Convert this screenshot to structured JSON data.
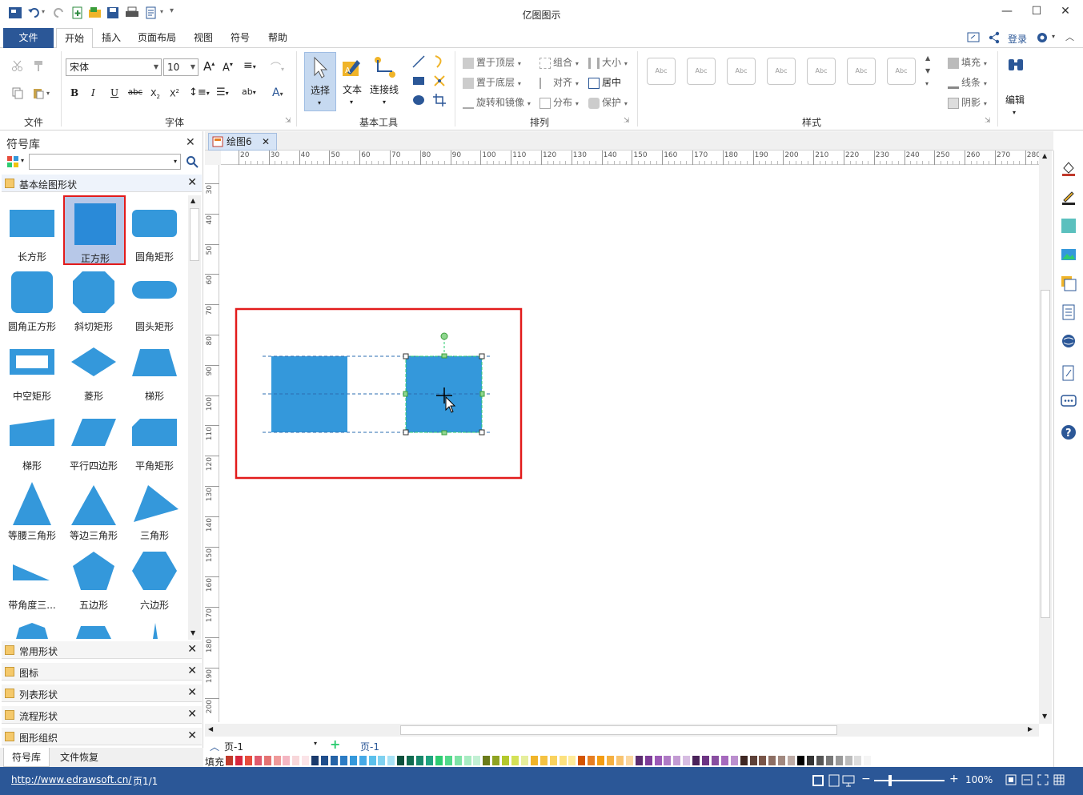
{
  "app": {
    "title": "亿图图示"
  },
  "menu": [
    "文件",
    "开始",
    "插入",
    "页面布局",
    "视图",
    "符号",
    "帮助"
  ],
  "account": {
    "login": "登录"
  },
  "ribbon": {
    "groups": {
      "file": "文件",
      "font": "字体",
      "basic_tools": "基本工具",
      "arrange": "排列",
      "style": "样式"
    },
    "font": {
      "family": "宋体",
      "size": "10"
    },
    "tools": {
      "select": "选择",
      "text": "文本",
      "connector": "连接线"
    },
    "arrange": {
      "bring_front": "置于顶层",
      "group": "组合",
      "size": "大小",
      "send_back": "置于底层",
      "align": "对齐",
      "center": "居中",
      "rotate_mirror": "旋转和镜像",
      "distribute": "分布",
      "protect": "保护"
    },
    "style_thumbs": [
      "Abc",
      "Abc",
      "Abc",
      "Abc",
      "Abc",
      "Abc",
      "Abc"
    ],
    "fill": {
      "fill": "填充",
      "line": "线条",
      "shadow": "阴影"
    },
    "edit": "编辑"
  },
  "library": {
    "title": "符号库",
    "section": "基本绘图形状",
    "shapes": [
      "长方形",
      "正方形",
      "圆角矩形",
      "圆角正方形",
      "斜切矩形",
      "圆头矩形",
      "中空矩形",
      "菱形",
      "梯形",
      "梯形",
      "平行四边形",
      "平角矩形",
      "等腰三角形",
      "等边三角形",
      "三角形",
      "带角度三...",
      "五边形",
      "六边形"
    ],
    "other_sections": [
      "常用形状",
      "图标",
      "列表形状",
      "流程形状",
      "图形组织"
    ],
    "bottom_tabs": [
      "符号库",
      "文件恢复"
    ]
  },
  "document": {
    "tab": "绘图6"
  },
  "rulers": {
    "h": [
      "20",
      "30",
      "40",
      "50",
      "60",
      "70",
      "80",
      "90",
      "100",
      "110",
      "120",
      "130",
      "140",
      "150",
      "160",
      "170",
      "180",
      "190",
      "200",
      "210",
      "220",
      "230",
      "240",
      "250",
      "260",
      "270",
      "280"
    ],
    "v": [
      "30",
      "40",
      "50",
      "60",
      "70",
      "80",
      "90",
      "100",
      "110",
      "120",
      "130",
      "140",
      "150",
      "160",
      "170",
      "180",
      "190",
      "200"
    ]
  },
  "pages": {
    "selector": "页-1",
    "tab": "页-1"
  },
  "colorbar": {
    "label": "填充"
  },
  "status": {
    "url": "http://www.edrawsoft.cn/",
    "page": "页1/1",
    "zoom": "100%"
  },
  "colors": {
    "accent": "#2b5797",
    "shape": "#3498db",
    "highlight": "#e21b1b"
  }
}
